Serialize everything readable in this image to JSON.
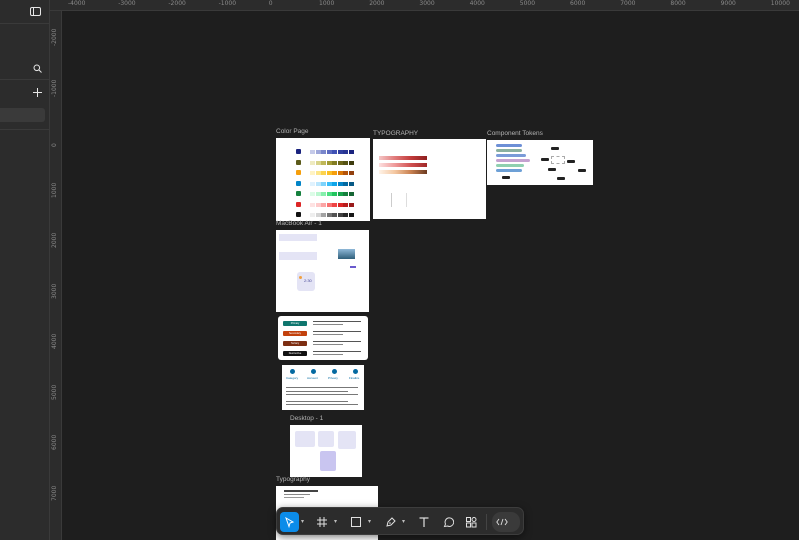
{
  "ruler": {
    "h_ticks": [
      "-4000",
      "-3000",
      "-2000",
      "-1000",
      "0",
      "1000",
      "2000",
      "3000",
      "4000",
      "5000",
      "6000",
      "7000",
      "8000",
      "9000",
      "10000"
    ],
    "v_ticks": [
      "-2000",
      "-1000",
      "0",
      "1000",
      "2000",
      "3000",
      "4000",
      "5000",
      "6000",
      "7000"
    ]
  },
  "frames": {
    "color_page": "Color Page",
    "typography_upper": "TYPOGRAPHY",
    "component_tokens": "Component Tokens",
    "macbook": "MacBook Air - 1",
    "desktop": "Desktop - 1",
    "typography": "Typography"
  },
  "mini_content": {
    "time_text": "2:30",
    "button_labels": [
      "Primary",
      "Secondary",
      "Tertiary",
      "Destructive"
    ],
    "step_labels": [
      "Category",
      "Account",
      "Privacy",
      "Finalize"
    ]
  },
  "toolbar": {
    "tools": [
      "move-tool",
      "frame-tool",
      "shape-tool",
      "pen-tool",
      "text-tool",
      "comment-tool",
      "actions-tool",
      "dev-mode-toggle"
    ]
  },
  "colors": {
    "bg": "#1e1e1e",
    "panel": "#2c2c2c",
    "accent": "#0c8ce9"
  }
}
